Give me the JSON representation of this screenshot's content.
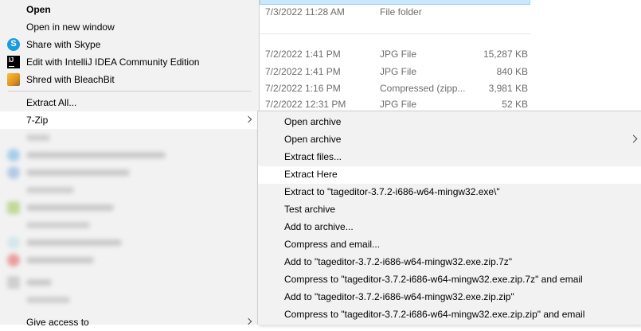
{
  "file_list": {
    "top_row": {
      "date": "7/3/2022 11:28 AM",
      "type": "File folder",
      "size": ""
    },
    "rows": [
      {
        "date": "7/2/2022 1:41 PM",
        "type": "JPG File",
        "size": "15,287 KB"
      },
      {
        "date": "7/2/2022 1:41 PM",
        "type": "JPG File",
        "size": "840 KB"
      },
      {
        "date": "7/2/2022 1:16 PM",
        "type": "Compressed (zipp...",
        "size": "3,981 KB"
      },
      {
        "date": "7/2/2022 12:31 PM",
        "type": "JPG File",
        "size": "52 KB"
      }
    ]
  },
  "context_menu": {
    "items": [
      {
        "label": "Open",
        "bold": true
      },
      {
        "label": "Open in new window"
      },
      {
        "label": "Share with Skype",
        "icon": "skype-icon"
      },
      {
        "label": "Edit with IntelliJ IDEA Community Edition",
        "icon": "intellij-icon"
      },
      {
        "label": "Shred with BleachBit",
        "icon": "bleachbit-icon"
      },
      {
        "label": "Extract All..."
      },
      {
        "label": "7-Zip",
        "submenu": true,
        "highlighted": true
      },
      {
        "label": "Give access to",
        "submenu": true
      }
    ]
  },
  "zip_submenu": {
    "items": [
      {
        "label": "Open archive"
      },
      {
        "label": "Open archive",
        "submenu": true
      },
      {
        "label": "Extract files..."
      },
      {
        "label": "Extract Here",
        "highlighted": true
      },
      {
        "label": "Extract to \"tageditor-3.7.2-i686-w64-mingw32.exe\\\""
      },
      {
        "label": "Test archive"
      },
      {
        "label": "Add to archive..."
      },
      {
        "label": "Compress and email..."
      },
      {
        "label": "Add to \"tageditor-3.7.2-i686-w64-mingw32.exe.zip.7z\""
      },
      {
        "label": "Compress to \"tageditor-3.7.2-i686-w64-mingw32.exe.zip.7z\" and email"
      },
      {
        "label": "Add to \"tageditor-3.7.2-i686-w64-mingw32.exe.zip.zip\""
      },
      {
        "label": "Compress to \"tageditor-3.7.2-i686-w64-mingw32.exe.zip.zip\" and email"
      }
    ]
  },
  "colors": {
    "menu_background": "#f2f2f2",
    "highlight": "#ffffff",
    "selection": "#cce8ff",
    "secondary_text": "#6d6d6d"
  }
}
